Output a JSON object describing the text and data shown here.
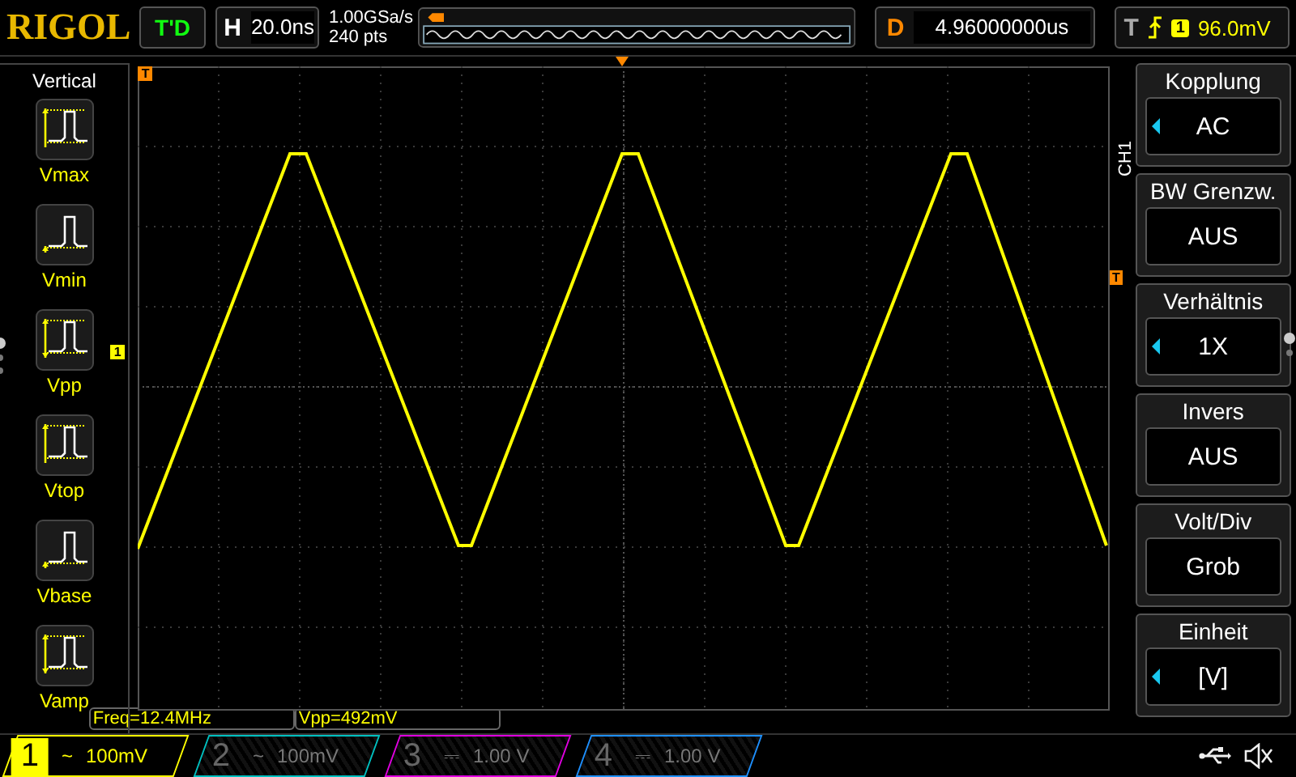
{
  "header": {
    "logo": "RIGOL",
    "run_status": "T'D",
    "horizontal": {
      "label": "H",
      "value": "20.0ns"
    },
    "sample_rate": "1.00GSa/s",
    "memory_depth": "240 pts",
    "delay": {
      "label": "D",
      "value": "4.96000000us"
    },
    "trigger": {
      "label": "T",
      "source": "1",
      "level": "96.0mV"
    }
  },
  "left_menu": {
    "title": "Vertical",
    "items": [
      {
        "label": "Vmax",
        "kind": "max"
      },
      {
        "label": "Vmin",
        "kind": "min"
      },
      {
        "label": "Vpp",
        "kind": "pp"
      },
      {
        "label": "Vtop",
        "kind": "top"
      },
      {
        "label": "Vbase",
        "kind": "base"
      },
      {
        "label": "Vamp",
        "kind": "amp"
      }
    ]
  },
  "screen": {
    "trigger_marker": "T",
    "level_marker": "T",
    "channel_marker": "1"
  },
  "measurements": [
    "Freq=12.4MHz",
    "Vpp=492mV"
  ],
  "right_menu": {
    "channel": "CH1",
    "items": [
      {
        "title": "Kopplung",
        "value": "AC",
        "adjustable": true
      },
      {
        "title": "BW Grenzw.",
        "value": "AUS",
        "adjustable": false
      },
      {
        "title": "Verhältnis",
        "value": "1X",
        "adjustable": true
      },
      {
        "title": "Invers",
        "value": "AUS",
        "adjustable": false
      },
      {
        "title": "Volt/Div",
        "value": "Grob",
        "adjustable": false
      },
      {
        "title": "Einheit",
        "value": "[V]",
        "adjustable": true
      }
    ]
  },
  "channels": [
    {
      "number": "1",
      "coupling": "~",
      "scale": "100mV",
      "active": true,
      "color": "#ffff00"
    },
    {
      "number": "2",
      "coupling": "~",
      "scale": "100mV",
      "active": false,
      "color": "#00c0c0"
    },
    {
      "number": "3",
      "coupling": "⎓",
      "scale": "1.00 V",
      "active": false,
      "color": "#e000e0"
    },
    {
      "number": "4",
      "coupling": "⎓",
      "scale": "1.00 V",
      "active": false,
      "color": "#1e90ff"
    }
  ]
}
